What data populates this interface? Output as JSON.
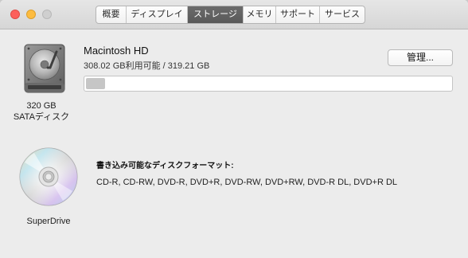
{
  "tabs": [
    {
      "label": "概要",
      "width": 38
    },
    {
      "label": "ディスプレイ",
      "width": 77
    },
    {
      "label": "ストレージ",
      "width": 70,
      "active": true
    },
    {
      "label": "メモリ",
      "width": 41
    },
    {
      "label": "サポート",
      "width": 55
    },
    {
      "label": "サービス",
      "width": 56
    }
  ],
  "disk": {
    "icon": "hard-drive-icon",
    "capacity_label": "320 GB",
    "type_label": "SATAディスク",
    "name": "Macintosh HD",
    "usage_text": "308.02 GB利用可能 / 319.21 GB",
    "manage_label": "管理...",
    "used_fraction": 0.035,
    "bar_fill_color": "#c6c6c6"
  },
  "optical": {
    "icon": "optical-disc-icon",
    "name": "SuperDrive",
    "formats_heading": "書き込み可能なディスクフォーマット:",
    "formats": "CD-R, CD-RW, DVD-R, DVD+R, DVD-RW, DVD+RW, DVD-R DL, DVD+R DL"
  },
  "colors": {
    "close": "#fc605c",
    "minimize": "#fdbc40",
    "zoom_disabled": "#cfcfcf",
    "active_tab": "#606060"
  }
}
